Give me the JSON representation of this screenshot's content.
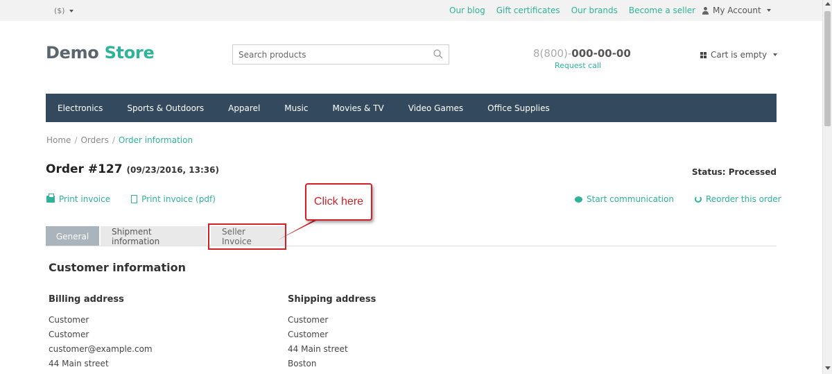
{
  "topbar": {
    "currency": "($)",
    "links": [
      "Our blog",
      "Gift certificates",
      "Our brands",
      "Become a seller"
    ],
    "account": "My Account"
  },
  "header": {
    "logo_part1": "Demo",
    "logo_part2": "Store",
    "search_placeholder": "Search products",
    "phone_prefix": "8(800)-",
    "phone_number": "000-00-00",
    "request_call": "Request call",
    "cart": "Cart is empty"
  },
  "nav": [
    "Electronics",
    "Sports & Outdoors",
    "Apparel",
    "Music",
    "Movies & TV",
    "Video Games",
    "Office Supplies"
  ],
  "breadcrumb": [
    "Home",
    "Orders",
    "Order information"
  ],
  "order": {
    "title": "Order #127",
    "datetime": "(09/23/2016, 13:36)",
    "status": "Status: Processed"
  },
  "actions": {
    "print_invoice": "Print invoice",
    "print_invoice_pdf": "Print invoice (pdf)",
    "start_communication": "Start communication",
    "reorder": "Reorder this order"
  },
  "tabs": [
    "General",
    "Shipment information",
    "Seller Invoice"
  ],
  "annotation": {
    "callout": "Click here",
    "color": "#d21f25"
  },
  "customer_info": {
    "title": "Customer information",
    "billing": {
      "title": "Billing address",
      "lines": [
        "Customer",
        "Customer",
        "customer@example.com",
        "44 Main street"
      ]
    },
    "shipping": {
      "title": "Shipping address",
      "lines": [
        "Customer",
        "Customer",
        "44 Main street",
        "Boston"
      ]
    }
  },
  "colors": {
    "accent": "#2eb398",
    "nav_bg": "#334a5e"
  }
}
